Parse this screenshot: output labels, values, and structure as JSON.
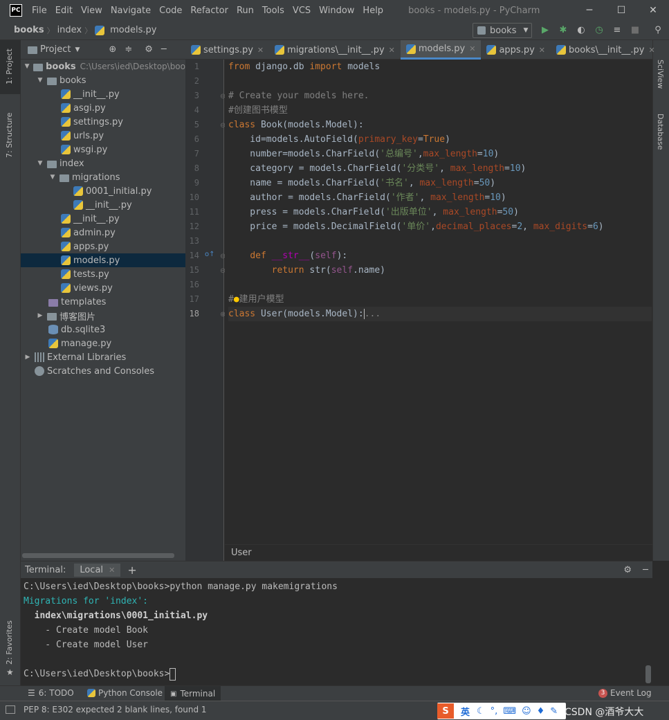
{
  "window": {
    "app_icon": "PC",
    "menu": [
      "File",
      "Edit",
      "View",
      "Navigate",
      "Code",
      "Refactor",
      "Run",
      "Tools",
      "VCS",
      "Window",
      "Help"
    ],
    "title": "books - models.py - PyCharm",
    "controls": [
      "─",
      "☐",
      "✕"
    ]
  },
  "nav": {
    "breadcrumb": [
      "books",
      "index",
      "models.py"
    ],
    "run_config": "books"
  },
  "left_strip": {
    "tabs": [
      "1: Project",
      "7: Structure",
      "2: Favorites"
    ]
  },
  "right_strip": {
    "tabs": [
      "SciView",
      "Database"
    ]
  },
  "project": {
    "header": "Project",
    "root_name": "books",
    "root_path": "C:\\Users\\ied\\Desktop\\boo",
    "items": [
      "books",
      "__init__.py",
      "asgi.py",
      "settings.py",
      "urls.py",
      "wsgi.py",
      "index",
      "migrations",
      "0001_initial.py",
      "__init__.py",
      "__init__.py",
      "admin.py",
      "apps.py",
      "models.py",
      "tests.py",
      "views.py",
      "templates",
      "博客图片",
      "db.sqlite3",
      "manage.py",
      "External Libraries",
      "Scratches and Consoles"
    ]
  },
  "tabs": [
    "settings.py",
    "migrations\\__init__.py",
    "models.py",
    "apps.py",
    "books\\__init__.py"
  ],
  "editor": {
    "line_numbers": [
      "1",
      "2",
      "3",
      "4",
      "5",
      "6",
      "7",
      "8",
      "9",
      "10",
      "11",
      "12",
      "13",
      "14",
      "15",
      "16",
      "17",
      "18"
    ],
    "crumb": "User"
  },
  "terminal": {
    "label": "Terminal:",
    "tab": "Local",
    "lines": [
      "C:\\Users\\ied\\Desktop\\books>python manage.py makemigrations",
      "Migrations for 'index':",
      "  index\\migrations\\0001_initial.py",
      "    - Create model Book",
      "    - Create model User",
      "",
      "C:\\Users\\ied\\Desktop\\books>"
    ]
  },
  "bottom_tabs": {
    "todo": "6: TODO",
    "python_console": "Python Console",
    "terminal": "Terminal",
    "event_badge": "3",
    "event_log": "Event Log"
  },
  "status": {
    "message": "PEP 8: E302 expected 2 blank lines, found 1",
    "ime_lang": "英",
    "watermark": "CSDN @酒爷大大"
  },
  "colors": {
    "accent": "#4a88c7",
    "selection": "#0d293e",
    "run_green": "#59a869"
  }
}
